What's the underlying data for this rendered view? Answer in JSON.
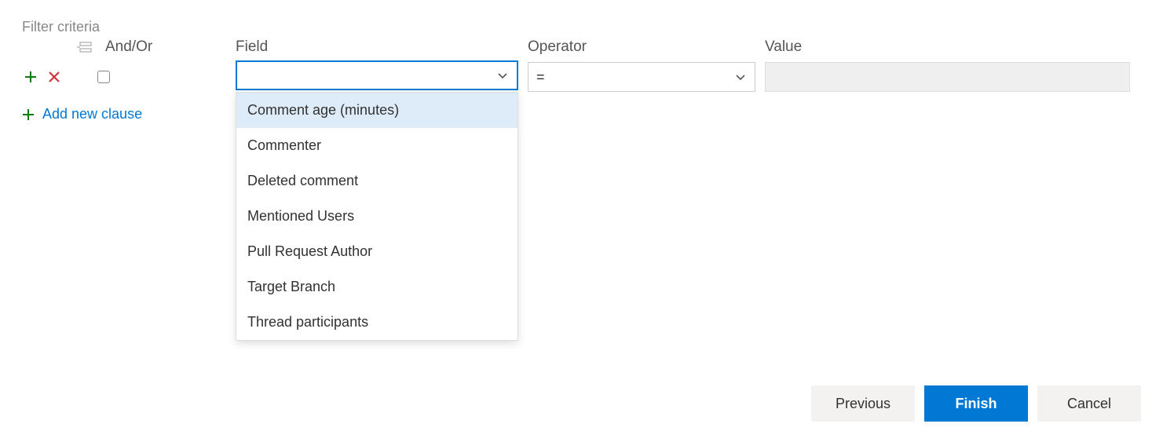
{
  "title": "Filter criteria",
  "headers": {
    "andor": "And/Or",
    "field": "Field",
    "operator": "Operator",
    "value": "Value"
  },
  "row": {
    "field_value": "",
    "operator_value": "=",
    "value_value": ""
  },
  "field_options": [
    "Comment age (minutes)",
    "Commenter",
    "Deleted comment",
    "Mentioned Users",
    "Pull Request Author",
    "Target Branch",
    "Thread participants"
  ],
  "field_selected_index": 0,
  "add_clause_label": "Add new clause",
  "buttons": {
    "previous": "Previous",
    "finish": "Finish",
    "cancel": "Cancel"
  },
  "colors": {
    "primary": "#0078d4",
    "green": "#107c10",
    "red": "#d13438",
    "highlight": "#deecf9"
  }
}
